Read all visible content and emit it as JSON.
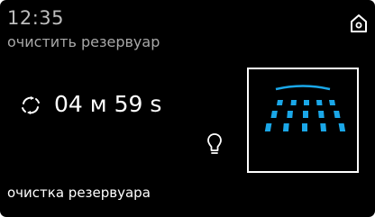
{
  "header": {
    "time": "12:35",
    "subtitle": "очистить резервуар"
  },
  "icons": {
    "home": "home-icon",
    "timer": "cycle-timer-icon",
    "light": "light-bulb-icon",
    "shower": "shower-spray-icon"
  },
  "timer": {
    "text": "04 м 59 s"
  },
  "status": {
    "text": "очистка резервуара"
  },
  "colors": {
    "background": "#000000",
    "accent": "#1aa7e8",
    "text": "#ffffff",
    "muted_text": "#a8a8a8"
  }
}
